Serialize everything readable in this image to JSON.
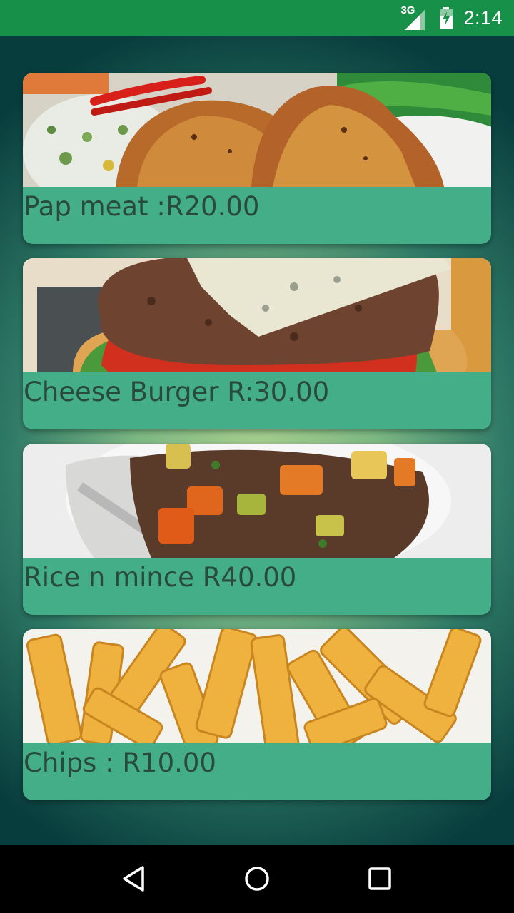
{
  "status_bar": {
    "network": "3G",
    "time": "2:14"
  },
  "menu": {
    "items": [
      {
        "label": "Pap meat :R20.00",
        "image": "grilled-chicken-with-pap-photo"
      },
      {
        "label": "Cheese Burger R:30.00",
        "image": "cheese-burger-photo"
      },
      {
        "label": "Rice n mince R40.00",
        "image": "rice-and-mince-photo"
      },
      {
        "label": "Chips : R10.00",
        "image": "chips-photo"
      }
    ]
  },
  "navigation": {
    "back": "back-icon",
    "home": "home-icon",
    "recents": "recents-icon"
  },
  "colors": {
    "status_bar": "#17914a",
    "card": "#43ae88",
    "label_text": "#2a4a3e"
  }
}
